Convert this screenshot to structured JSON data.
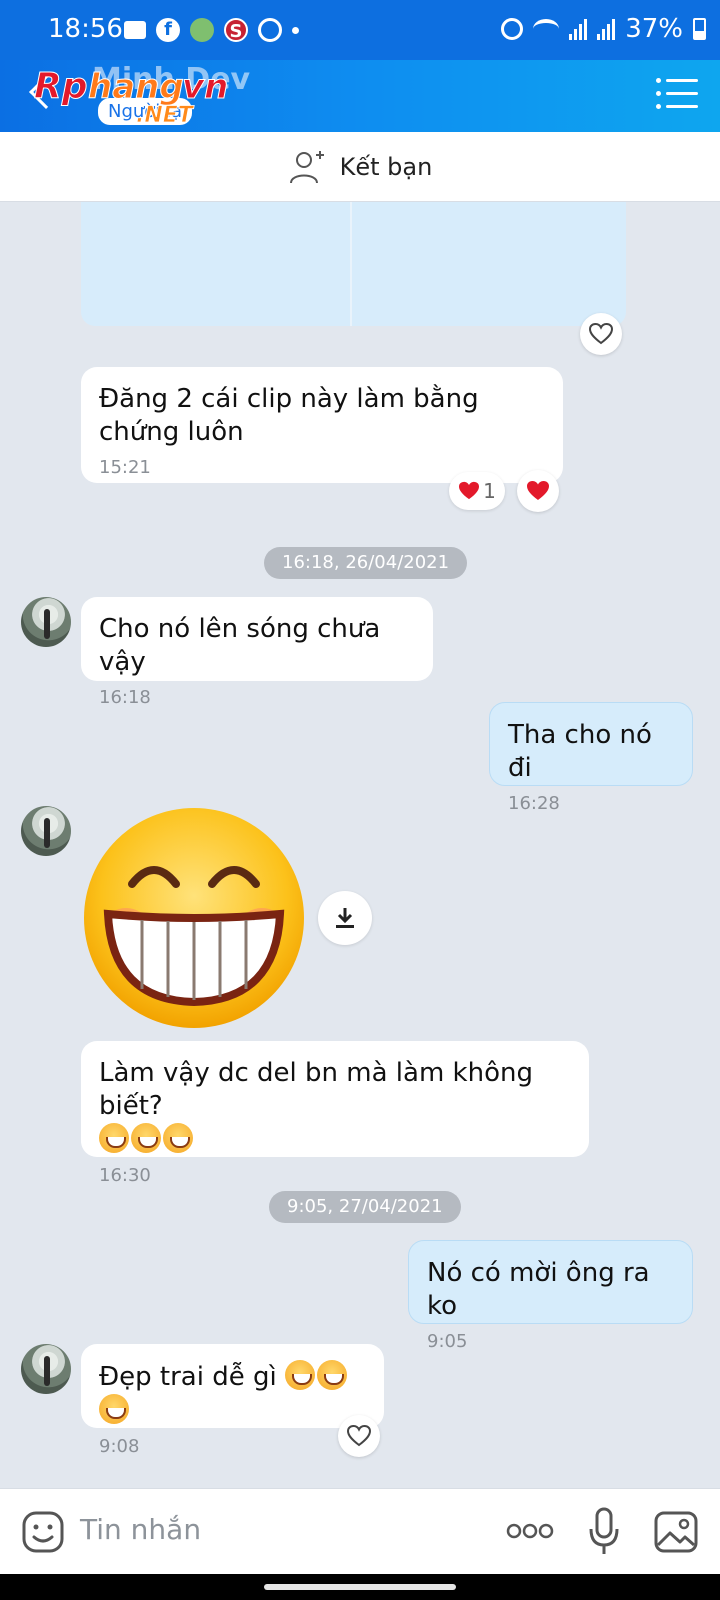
{
  "status_bar": {
    "time": "18:56",
    "battery": "37%"
  },
  "header": {
    "contact_name": "Minh Dev",
    "contact_sub": "Người lạ",
    "logo_text": "Rphangvn",
    "logo_suffix": ".NET"
  },
  "add_friend": {
    "label": "Kết bạn"
  },
  "messages": [
    {
      "text": "Đăng 2 cái clip này làm bằng chứng luôn",
      "time": "15:21",
      "reaction_count": "1"
    },
    {
      "date": "16:18, 26/04/2021"
    },
    {
      "text": "Cho nó lên sóng chưa vậy",
      "time": "16:18"
    },
    {
      "text": "Tha cho nó đi",
      "time": "16:28"
    },
    {
      "text": "Làm vậy dc del bn mà làm không biết?",
      "time": "16:30"
    },
    {
      "date": "9:05, 27/04/2021"
    },
    {
      "text": "Nó có mời ông ra ko",
      "time": "9:05"
    },
    {
      "text": "Đẹp trai dễ gì",
      "time": "9:08"
    }
  ],
  "composer": {
    "placeholder": "Tin nhắn"
  },
  "colors": {
    "accent": "#0d6fe0",
    "mine_bubble": "#d6ecfb",
    "heart": "#e3192b",
    "background": "#e2e7ee"
  }
}
